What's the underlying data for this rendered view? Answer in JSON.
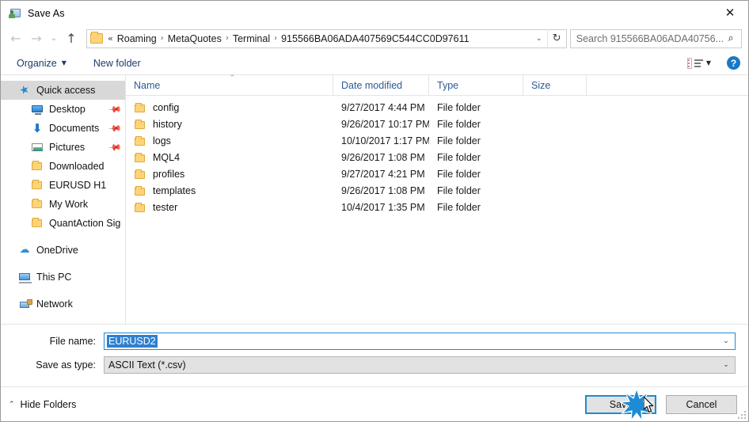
{
  "window": {
    "title": "Save As",
    "icon": "save-as-app-icon",
    "close_label": "✕"
  },
  "nav": {
    "back_label": "←",
    "forward_label": "→",
    "recent_label": "⌄",
    "up_label": "↑",
    "refresh_label": "↻",
    "dropdown_label": "⌄",
    "breadcrumb_prefix": "«",
    "separator": "›",
    "crumbs": [
      {
        "label": "Roaming"
      },
      {
        "label": "MetaQuotes"
      },
      {
        "label": "Terminal"
      },
      {
        "label": "915566BA06ADA407569C544CC0D97611"
      }
    ]
  },
  "search": {
    "placeholder": "Search 915566BA06ADA40756...",
    "icon": "search-icon"
  },
  "toolbar": {
    "organize_label": "Organize",
    "organize_caret": "▼",
    "new_folder_label": "New folder",
    "view_caret": "▼",
    "help_label": "?"
  },
  "sidebar": {
    "items": [
      {
        "label": "Quick access",
        "icon": "star-icon",
        "level": 0,
        "selected": true,
        "pinned": false
      },
      {
        "label": "Desktop",
        "icon": "desktop-icon",
        "level": 1,
        "selected": false,
        "pinned": true
      },
      {
        "label": "Documents",
        "icon": "documents-icon",
        "level": 1,
        "selected": false,
        "pinned": true
      },
      {
        "label": "Pictures",
        "icon": "pictures-icon",
        "level": 1,
        "selected": false,
        "pinned": true
      },
      {
        "label": "Downloaded",
        "icon": "folder-icon",
        "level": 1,
        "selected": false,
        "pinned": false
      },
      {
        "label": "EURUSD H1",
        "icon": "folder-icon",
        "level": 1,
        "selected": false,
        "pinned": false
      },
      {
        "label": "My Work",
        "icon": "folder-icon",
        "level": 1,
        "selected": false,
        "pinned": false
      },
      {
        "label": "QuantAction Signal",
        "icon": "folder-icon",
        "level": 1,
        "selected": false,
        "pinned": false
      },
      {
        "label": "OneDrive",
        "icon": "onedrive-icon",
        "level": 0,
        "selected": false,
        "pinned": false,
        "gap_before": true
      },
      {
        "label": "This PC",
        "icon": "this-pc-icon",
        "level": 0,
        "selected": false,
        "pinned": false,
        "gap_before": true
      },
      {
        "label": "Network",
        "icon": "network-icon",
        "level": 0,
        "selected": false,
        "pinned": false,
        "gap_before": true
      }
    ],
    "pin_glyph": "📌"
  },
  "filelist": {
    "columns": [
      {
        "key": "name",
        "label": "Name",
        "sorted": "asc"
      },
      {
        "key": "date",
        "label": "Date modified",
        "sorted": null
      },
      {
        "key": "type",
        "label": "Type",
        "sorted": null
      },
      {
        "key": "size",
        "label": "Size",
        "sorted": null
      }
    ],
    "sort_arrow": "⌃",
    "rows": [
      {
        "name": "config",
        "date": "9/27/2017 4:44 PM",
        "type": "File folder",
        "size": ""
      },
      {
        "name": "history",
        "date": "9/26/2017 10:17 PM",
        "type": "File folder",
        "size": ""
      },
      {
        "name": "logs",
        "date": "10/10/2017 1:17 PM",
        "type": "File folder",
        "size": ""
      },
      {
        "name": "MQL4",
        "date": "9/26/2017 1:08 PM",
        "type": "File folder",
        "size": ""
      },
      {
        "name": "profiles",
        "date": "9/27/2017 4:21 PM",
        "type": "File folder",
        "size": ""
      },
      {
        "name": "templates",
        "date": "9/26/2017 1:08 PM",
        "type": "File folder",
        "size": ""
      },
      {
        "name": "tester",
        "date": "10/4/2017 1:35 PM",
        "type": "File folder",
        "size": ""
      }
    ]
  },
  "form": {
    "filename_label": "File name:",
    "filename_value": "EURUSD2",
    "filename_selected": true,
    "filetype_label": "Save as type:",
    "filetype_value": "ASCII Text (*.csv)",
    "dropdown_caret": "⌄"
  },
  "footer": {
    "hide_folders_label": "Hide Folders",
    "hide_folders_caret": "⌃",
    "save_label": "Save",
    "cancel_label": "Cancel"
  },
  "colors": {
    "accent_blue": "#1e8bd4",
    "selection_blue": "#2f7fd0",
    "sidebar_selected": "#d8d8d8",
    "header_text": "#2c5a93",
    "folder_yellow": "#ffd479",
    "help_blue": "#1878c8"
  }
}
